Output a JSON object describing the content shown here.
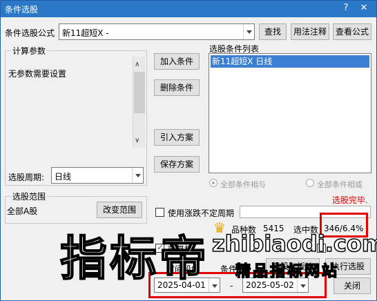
{
  "window": {
    "title": "条件选股"
  },
  "formula": {
    "label": "条件选股公式",
    "value": "新11超短X  -",
    "find_btn": "查找",
    "usage_btn": "用法注释",
    "view_btn": "查看公式"
  },
  "params": {
    "title": "计算参数",
    "text": "无参数需要设置",
    "period_label": "选股周期:",
    "period_value": "日线"
  },
  "buttons": {
    "add": "加入条件",
    "delete": "删除条件",
    "import": "引入方案",
    "save": "保存方案"
  },
  "conditions": {
    "title": "选股条件列表",
    "items": [
      "新11超短X  日线"
    ],
    "radio_and": "全部条件相与",
    "radio_or": "全部条件相或"
  },
  "status": {
    "done": "选股完毕."
  },
  "range": {
    "title": "选股范围",
    "value": "全部A股",
    "change_btn": "改变范围"
  },
  "options": {
    "use_limit": "使用涨跌不定周期",
    "total_label": "品种数",
    "total_value": "5415",
    "selected_label": "选中数",
    "selected_value": "346/6.4%",
    "prev_label": "前复权",
    "time_label": "时间段内",
    "condition_tail": "条件",
    "select_btn": "选股入板块",
    "run_btn": "执行选股",
    "date_start": "2025-04-01",
    "date_sep": "-",
    "date_end": "2025-05-02",
    "close_btn": "关闭"
  },
  "watermark": {
    "logo_text": "指标帝",
    "url": "zhibiaodi.com",
    "sub": "精品指标网站"
  },
  "colors": {
    "title_bar": "#2b78c9",
    "selection": "#3b7fd0",
    "done_text": "#e00000",
    "highlight_box": "#e00000"
  }
}
